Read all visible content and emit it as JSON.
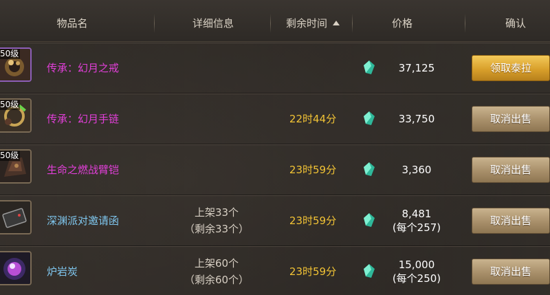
{
  "header": {
    "col_name": "物品名",
    "col_detail": "详细信息",
    "col_time": "剩余时间",
    "col_price": "价格",
    "col_confirm": "确认"
  },
  "rows": [
    {
      "level": "50级",
      "name": "传承：幻月之戒",
      "detail1": "",
      "detail2": "",
      "time": "",
      "price": "37,125",
      "price_each": "",
      "button": "领取泰拉",
      "icon": "ring-item-icon"
    },
    {
      "level": "50级",
      "name": "传承：幻月手链",
      "detail1": "",
      "detail2": "",
      "time": "22时44分",
      "price": "33,750",
      "price_each": "",
      "button": "取消出售",
      "icon": "bracelet-item-icon"
    },
    {
      "level": "50级",
      "name": "生命之燃战臂铠",
      "detail1": "",
      "detail2": "",
      "time": "23时59分",
      "price": "3,360",
      "price_each": "",
      "button": "取消出售",
      "icon": "armguard-item-icon"
    },
    {
      "level": "",
      "name": "深渊派对邀请函",
      "detail1": "上架33个",
      "detail2": "（剩余33个）",
      "time": "23时59分",
      "price": "8,481",
      "price_each": "(每个257)",
      "button": "取消出售",
      "icon": "invitation-item-icon"
    },
    {
      "level": "",
      "name": "炉岩炭",
      "detail1": "上架60个",
      "detail2": "（剩余60个）",
      "time": "23时59分",
      "price": "15,000",
      "price_each": "(每个250)",
      "button": "取消出售",
      "icon": "coal-orb-item-icon"
    }
  ],
  "colors": {
    "epic_name": "#e23fd9",
    "rare_name": "#7fc6ee",
    "time": "#f2c335",
    "gold_button": "#d9a02b",
    "tan_button": "#a88f6a"
  },
  "currency_icon": "tera-gem-icon"
}
